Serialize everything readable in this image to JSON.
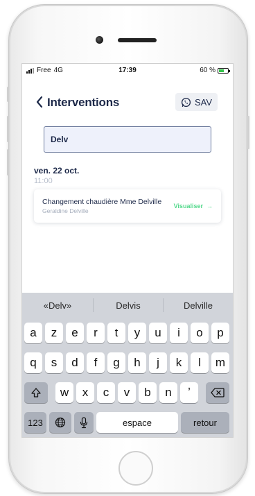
{
  "status_bar": {
    "carrier": "Free",
    "network": "4G",
    "time": "17:39",
    "battery": "60 %",
    "battery_level": 0.6
  },
  "header": {
    "title": "Interventions",
    "sav_label": "SAV"
  },
  "search": {
    "value": "Delv"
  },
  "group": {
    "date": "ven. 22 oct.",
    "time": "11:00"
  },
  "card": {
    "title": "Changement chaudière Mme Delville",
    "subtitle": "Geraldine Delville",
    "action": "Visualiser"
  },
  "keyboard": {
    "suggestions": [
      "«Delv»",
      "Delvis",
      "Delville"
    ],
    "row1": [
      "a",
      "z",
      "e",
      "r",
      "t",
      "y",
      "u",
      "i",
      "o",
      "p"
    ],
    "row2": [
      "q",
      "s",
      "d",
      "f",
      "g",
      "h",
      "j",
      "k",
      "l",
      "m"
    ],
    "row3": [
      "w",
      "x",
      "c",
      "v",
      "b",
      "n",
      "ʼ"
    ],
    "numbers_label": "123",
    "space_label": "espace",
    "return_label": "retour"
  },
  "colors": {
    "accent_green": "#54d98c",
    "navy": "#1e2a4a",
    "battery": "#33c44a"
  }
}
